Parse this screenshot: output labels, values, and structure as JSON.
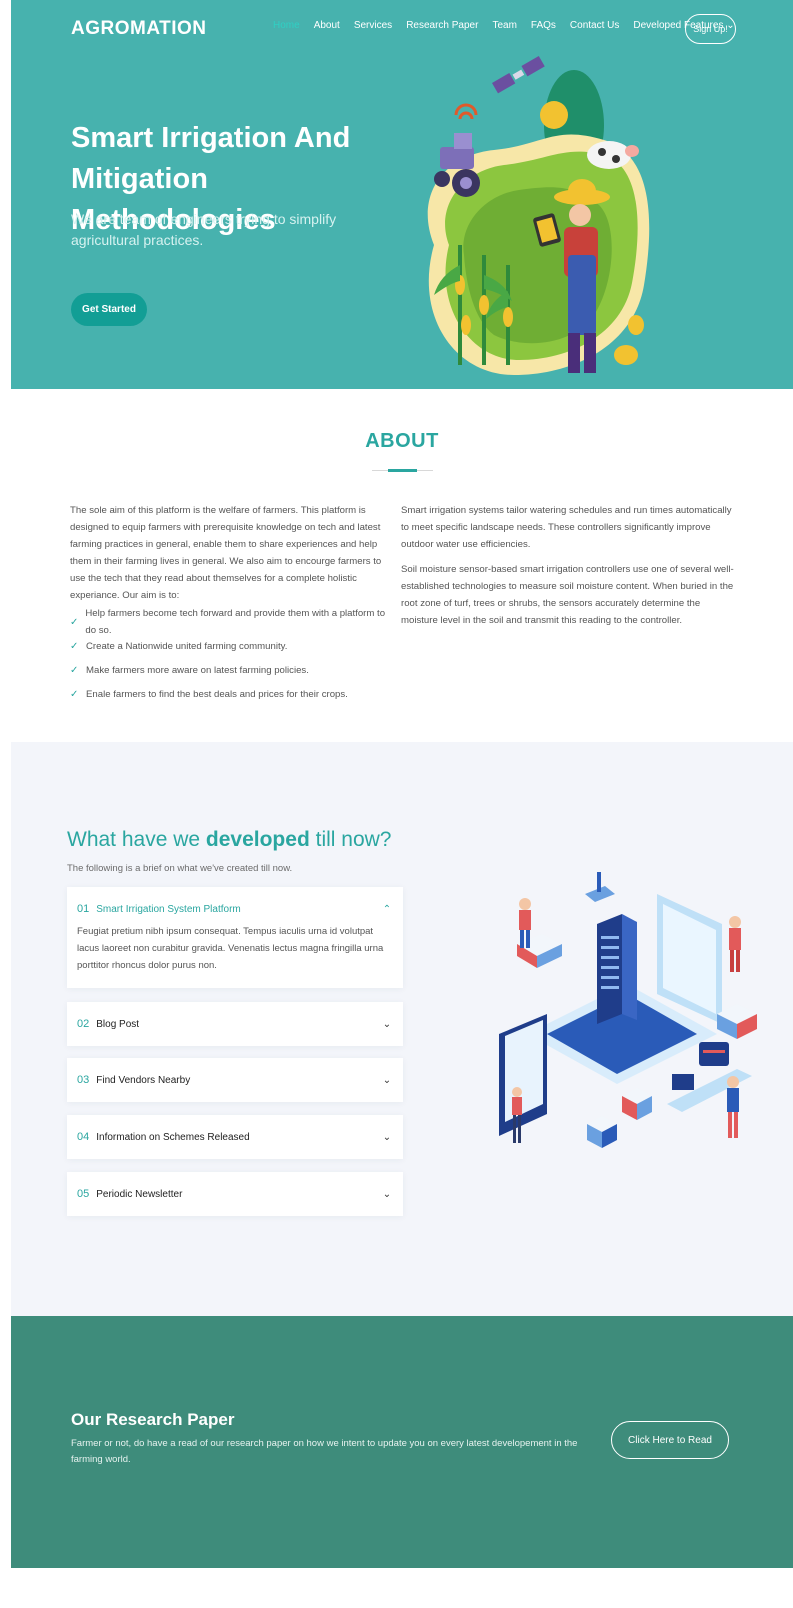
{
  "brand": {
    "logo": "AGROMATION"
  },
  "nav": {
    "items": [
      {
        "label": "Home",
        "active": true
      },
      {
        "label": "About"
      },
      {
        "label": "Services"
      },
      {
        "label": "Research Paper"
      },
      {
        "label": "Team"
      },
      {
        "label": "FAQs"
      },
      {
        "label": "Contact Us"
      },
      {
        "label": "Developed Features ⌄"
      }
    ],
    "signup": "Sign Up!"
  },
  "hero": {
    "title": "Smart Irrigation And Mitigation Methodologies",
    "subtitle": "We are team of engineers trying to simplify agricultural practices.",
    "cta": "Get Started"
  },
  "about": {
    "title": "ABOUT",
    "left_text": "The sole aim of this platform is the welfare of farmers. This platform is designed to equip farmers with prerequisite knowledge on tech and latest farming practices in general, enable them to share experiences and help them in their farming lives in general. We also aim to encourge farmers to use the tech that they read about themselves for a complete holistic experiance. Our aim is to:",
    "bullets": [
      "Help farmers become tech forward and provide them with a platform to do so.",
      "Create a Nationwide united farming community.",
      "Make farmers more aware on latest farming policies.",
      "Enale farmers to find the best deals and prices for their crops."
    ],
    "right_p1": "Smart irrigation systems tailor watering schedules and run times automatically to meet specific landscape needs. These controllers significantly improve outdoor water use efficiencies.",
    "right_p2": "Soil moisture sensor-based smart irrigation controllers use one of several well-established technologies to measure soil moisture content. When buried in the root zone of turf, trees or shrubs, the sensors accurately determine the moisture level in the soil and transmit this reading to the controller."
  },
  "developed": {
    "title_pre": "What have we ",
    "title_bold": "developed",
    "title_post": " till now?",
    "subtitle": "The following is a brief on what we've created till now.",
    "items": [
      {
        "num": "01",
        "label": "Smart Irrigation System Platform",
        "open": true,
        "body": "Feugiat pretium nibh ipsum consequat. Tempus iaculis urna id volutpat lacus laoreet non curabitur gravida. Venenatis lectus magna fringilla urna porttitor rhoncus dolor purus non."
      },
      {
        "num": "02",
        "label": "Blog Post"
      },
      {
        "num": "03",
        "label": "Find Vendors Nearby"
      },
      {
        "num": "04",
        "label": "Information on Schemes Released"
      },
      {
        "num": "05",
        "label": "Periodic Newsletter"
      }
    ],
    "icons": {
      "open": "chevron-up-icon",
      "closed": "chevron-down-icon"
    }
  },
  "research": {
    "title": "Our Research Paper",
    "text": "Farmer or not, do have a read of our research paper on how we intent to update you on every latest developement in the farming world.",
    "button": "Click Here to Read"
  },
  "colors": {
    "hero_bg": "#47b2ae",
    "accent": "#2aa6a0",
    "research_bg": "#3e8c7b",
    "section_bg": "#f3f5fa"
  }
}
